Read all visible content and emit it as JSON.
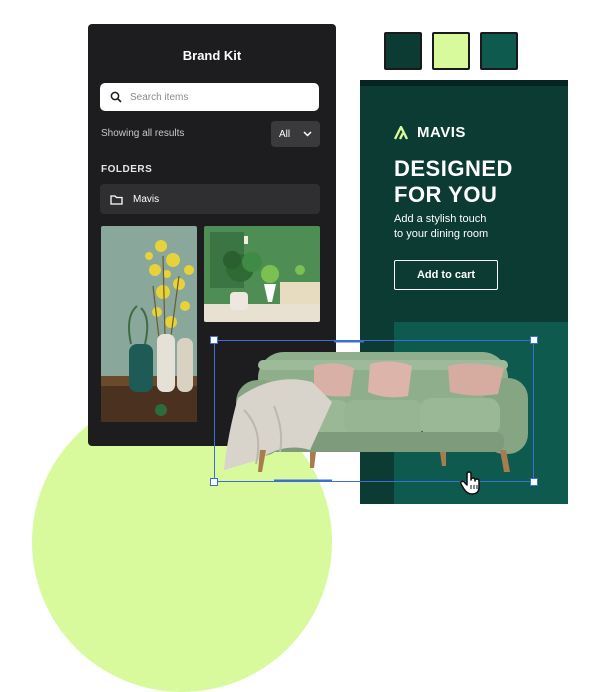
{
  "colors": {
    "swatches": [
      "#0b3b32",
      "#d9f99d",
      "#0e5a4f"
    ],
    "panel_bg": "#1d1d1f",
    "ad_bg": "#0b3b32",
    "accent_lime": "#d9f99d",
    "selection": "#3b6fd6"
  },
  "panel": {
    "title": "Brand Kit",
    "search_placeholder": "Search items",
    "results_label": "Showing all results",
    "filter_value": "All",
    "folders_heading": "FOLDERS",
    "folder_name": "Mavis"
  },
  "ad": {
    "brand": "MAVIS",
    "headline_line1": "DESIGNED",
    "headline_line2": "FOR YOU",
    "subtext_line1": "Add a stylish touch",
    "subtext_line2": "to your dining room",
    "cta": "Add to cart"
  },
  "icons": [
    "search-icon",
    "chevron-down-icon",
    "folder-icon",
    "mavis-logo-icon",
    "hand-pointer-icon"
  ]
}
